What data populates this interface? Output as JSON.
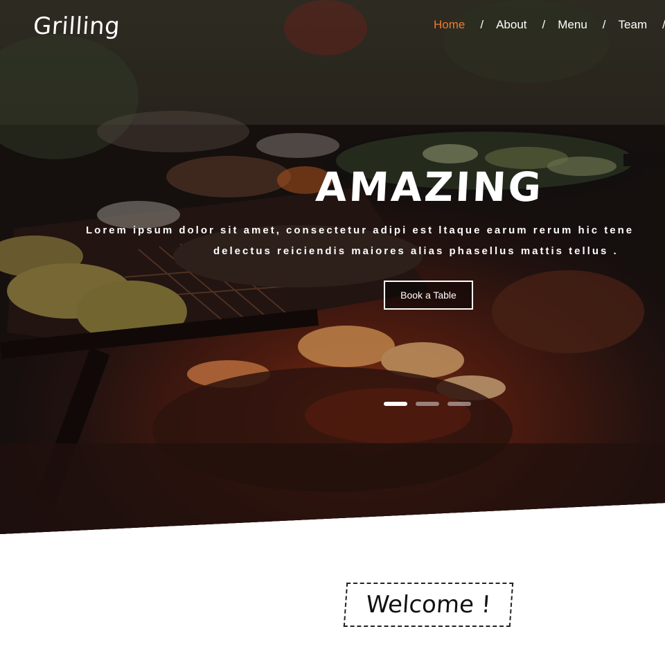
{
  "header": {
    "brand": "Grilling",
    "nav": [
      {
        "label": "Home",
        "active": true
      },
      {
        "label": "About",
        "active": false
      },
      {
        "label": "Menu",
        "active": false
      },
      {
        "label": "Team",
        "active": false
      }
    ],
    "separator": "/"
  },
  "hero": {
    "title": "AMAZING",
    "text_line1": "Lorem ipsum dolor sit amet, consectetur adipi est ltaque earum rerum hic tene",
    "text_line2": "delectus reiciendis maiores alias phasellus mattis tellus .",
    "button_label": "Book a Table",
    "slides": 3,
    "active_slide": 1
  },
  "welcome": {
    "title": "Welcome !"
  },
  "colors": {
    "accent": "#f07a2b",
    "text_light": "#ffffff",
    "text_dark": "#111111"
  }
}
